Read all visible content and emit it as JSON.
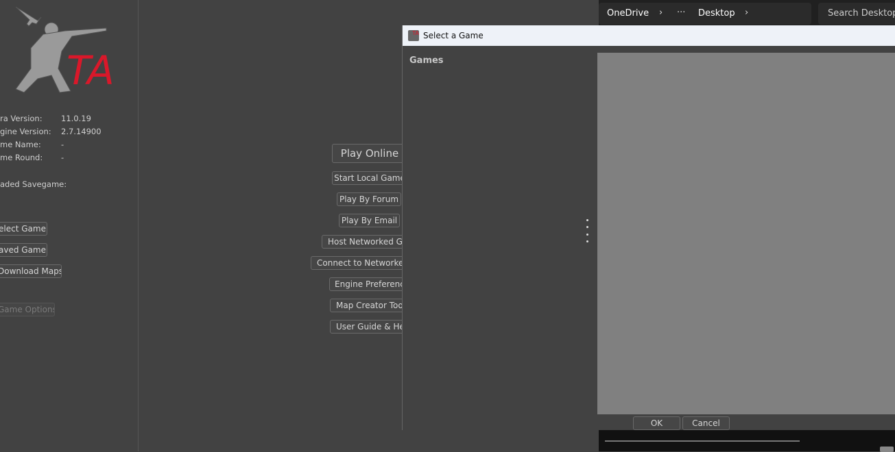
{
  "left_panel": {
    "info": [
      {
        "label": "ra Version:",
        "value": "11.0.19"
      },
      {
        "label": "gine Version:",
        "value": "2.7.14900"
      },
      {
        "label": "me Name:",
        "value": "-"
      },
      {
        "label": "me Round:",
        "value": "-"
      }
    ],
    "loaded_savegame_label": "aded Savegame:",
    "buttons": {
      "select_game": "elect Game",
      "saved_game": "aved Game",
      "download_maps": "Download Maps",
      "game_options": "Game Options"
    },
    "logo_text": "TA"
  },
  "main_menu": {
    "play_online": "Play Online",
    "start_local": "Start Local Game",
    "play_by_forum": "Play By Forum",
    "play_by_email": "Play By Email",
    "host_networked": "Host Networked Gar",
    "connect_networked": "Connect to Networked (",
    "engine_prefs": "Engine Preferences",
    "map_creator": "Map Creator Tools",
    "user_guide": "User Guide & Help"
  },
  "explorer": {
    "breadcrumb": [
      "OneDrive",
      "Desktop"
    ],
    "more": "···",
    "search_placeholder": "Search Desktop"
  },
  "dialog": {
    "title": "Select a Game",
    "games_label": "Games",
    "ok": "OK",
    "cancel": "Cancel"
  },
  "colors": {
    "logo_red": "#d9182a",
    "background": "#424242",
    "preview": "#808080"
  }
}
